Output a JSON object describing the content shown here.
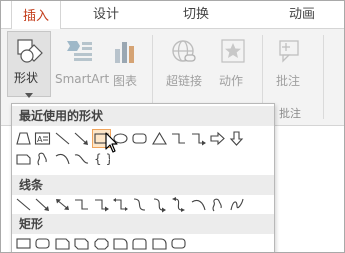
{
  "tabs": [
    {
      "label": "插入",
      "active": true
    },
    {
      "label": "设计",
      "active": false
    },
    {
      "label": "切换",
      "active": false
    },
    {
      "label": "动画",
      "active": false
    }
  ],
  "ribbon": {
    "shapes_label": "形状",
    "smartart_label": "SmartArt",
    "chart_label": "图表",
    "hyperlink_label": "超链接",
    "action_label": "动作",
    "comment_label": "批注",
    "comment_group": "批注"
  },
  "gallery": {
    "recent_title": "最近使用的形状",
    "lines_title": "线条",
    "rect_title": "矩形"
  },
  "colors": {
    "accent": "#c43e1c",
    "ribbon_bg": "#f3f3f3",
    "shape_stroke": "#444444",
    "hover_border": "#f0a45c"
  }
}
